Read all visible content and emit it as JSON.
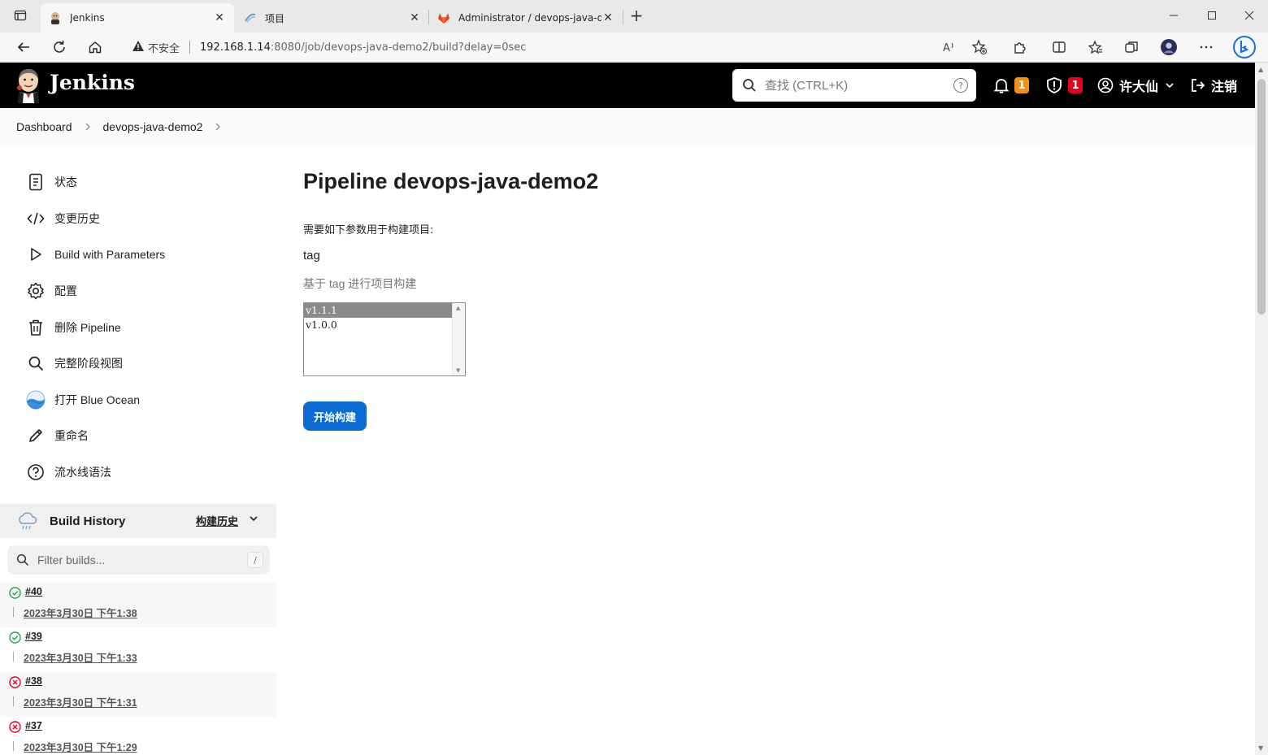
{
  "browser": {
    "tabs": [
      {
        "title": "Jenkins",
        "favicon": "jenkins-favicon",
        "active": true
      },
      {
        "title": "项目",
        "favicon": "kuboard-favicon",
        "active": false
      },
      {
        "title": "Administrator / devops-java-dem",
        "favicon": "gitlab-favicon",
        "active": false
      }
    ],
    "new_tab": "+",
    "address": {
      "security_label": "不安全",
      "host": "192.168.1.14",
      "path": ":8080/job/devops-java-demo2/build?delay=0sec"
    }
  },
  "header": {
    "brand": "Jenkins",
    "search_placeholder": "查找 (CTRL+K)",
    "search_help": "?",
    "notifications_count": "1",
    "security_count": "1",
    "user_name": "许大仙",
    "logout_label": "注销"
  },
  "breadcrumbs": [
    "Dashboard",
    "devops-java-demo2"
  ],
  "sidebar": {
    "items": [
      {
        "label": "状态",
        "icon": "document-icon"
      },
      {
        "label": "变更历史",
        "icon": "code-icon"
      },
      {
        "label": "Build with Parameters",
        "icon": "play-icon"
      },
      {
        "label": "配置",
        "icon": "gear-icon"
      },
      {
        "label": "删除 Pipeline",
        "icon": "trash-icon"
      },
      {
        "label": "完整阶段视图",
        "icon": "search-icon"
      },
      {
        "label": "打开 Blue Ocean",
        "icon": "blue-ocean-icon"
      },
      {
        "label": "重命名",
        "icon": "pencil-icon"
      },
      {
        "label": "流水线语法",
        "icon": "help-icon"
      }
    ]
  },
  "build_history": {
    "title": "Build History",
    "trend_link": "构建历史",
    "filter_placeholder": "Filter builds...",
    "filter_shortcut": "/",
    "builds": [
      {
        "number": "#40",
        "date": "2023年3月30日 下午1:38",
        "status": "success"
      },
      {
        "number": "#39",
        "date": "2023年3月30日 下午1:33",
        "status": "success"
      },
      {
        "number": "#38",
        "date": "2023年3月30日 下午1:31",
        "status": "failure"
      },
      {
        "number": "#37",
        "date": "2023年3月30日 下午1:29",
        "status": "failure"
      }
    ]
  },
  "main": {
    "title": "Pipeline devops-java-demo2",
    "description": "需要如下参数用于构建项目:",
    "parameter": {
      "name": "tag",
      "help": "基于 tag 进行项目构建",
      "options": [
        "v1.1.1",
        "v1.0.0"
      ],
      "selected": "v1.1.1"
    },
    "build_button": "开始构建"
  },
  "colors": {
    "primary_button": "#0b6bd3",
    "header_bg": "#000000",
    "success": "#1ea64b",
    "failure": "#e6001f",
    "badge_orange": "#f58f16"
  }
}
